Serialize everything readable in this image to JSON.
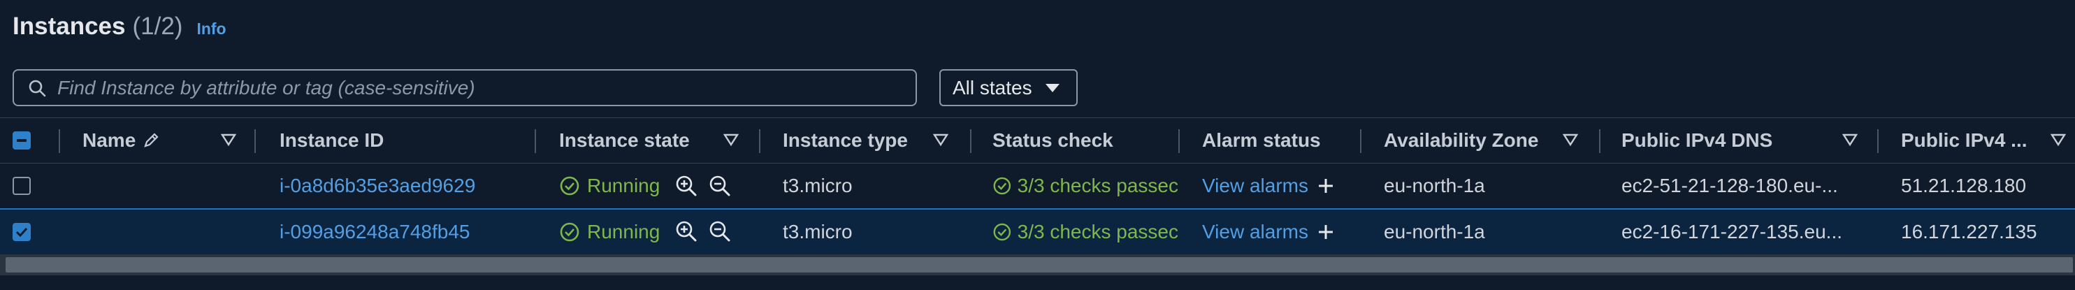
{
  "header": {
    "title": "Instances",
    "count": "(1/2)",
    "info": "Info"
  },
  "search": {
    "placeholder": "Find Instance by attribute or tag (case-sensitive)",
    "value": ""
  },
  "filter": {
    "selected": "All states"
  },
  "columns": {
    "name": "Name",
    "instance_id": "Instance ID",
    "instance_state": "Instance state",
    "instance_type": "Instance type",
    "status_check": "Status check",
    "alarm_status": "Alarm status",
    "availability_zone": "Availability Zone",
    "public_dns": "Public IPv4 DNS",
    "public_ip": "Public IPv4 ..."
  },
  "rows": [
    {
      "selected": false,
      "instance_id": "i-0a8d6b35e3aed9629",
      "state": "Running",
      "type": "t3.micro",
      "status": "3/3 checks passec",
      "alarm": "View alarms",
      "zone": "eu-north-1a",
      "dns": "ec2-51-21-128-180.eu-...",
      "ip": "51.21.128.180"
    },
    {
      "selected": true,
      "instance_id": "i-099a96248a748fb45",
      "state": "Running",
      "type": "t3.micro",
      "status": "3/3 checks passec",
      "alarm": "View alarms",
      "zone": "eu-north-1a",
      "dns": "ec2-16-171-227-135.eu...",
      "ip": "16.171.227.135"
    }
  ],
  "colors": {
    "link": "#539fe5",
    "running": "#7fb74a",
    "selected_row": "#0b2540",
    "accent": "#2e80c9"
  },
  "icons": [
    "search-icon",
    "caret-down-icon",
    "edit-icon",
    "sort-icon",
    "check-circle-icon",
    "zoom-in-icon",
    "zoom-out-icon",
    "plus-icon",
    "checkbox-icon"
  ]
}
